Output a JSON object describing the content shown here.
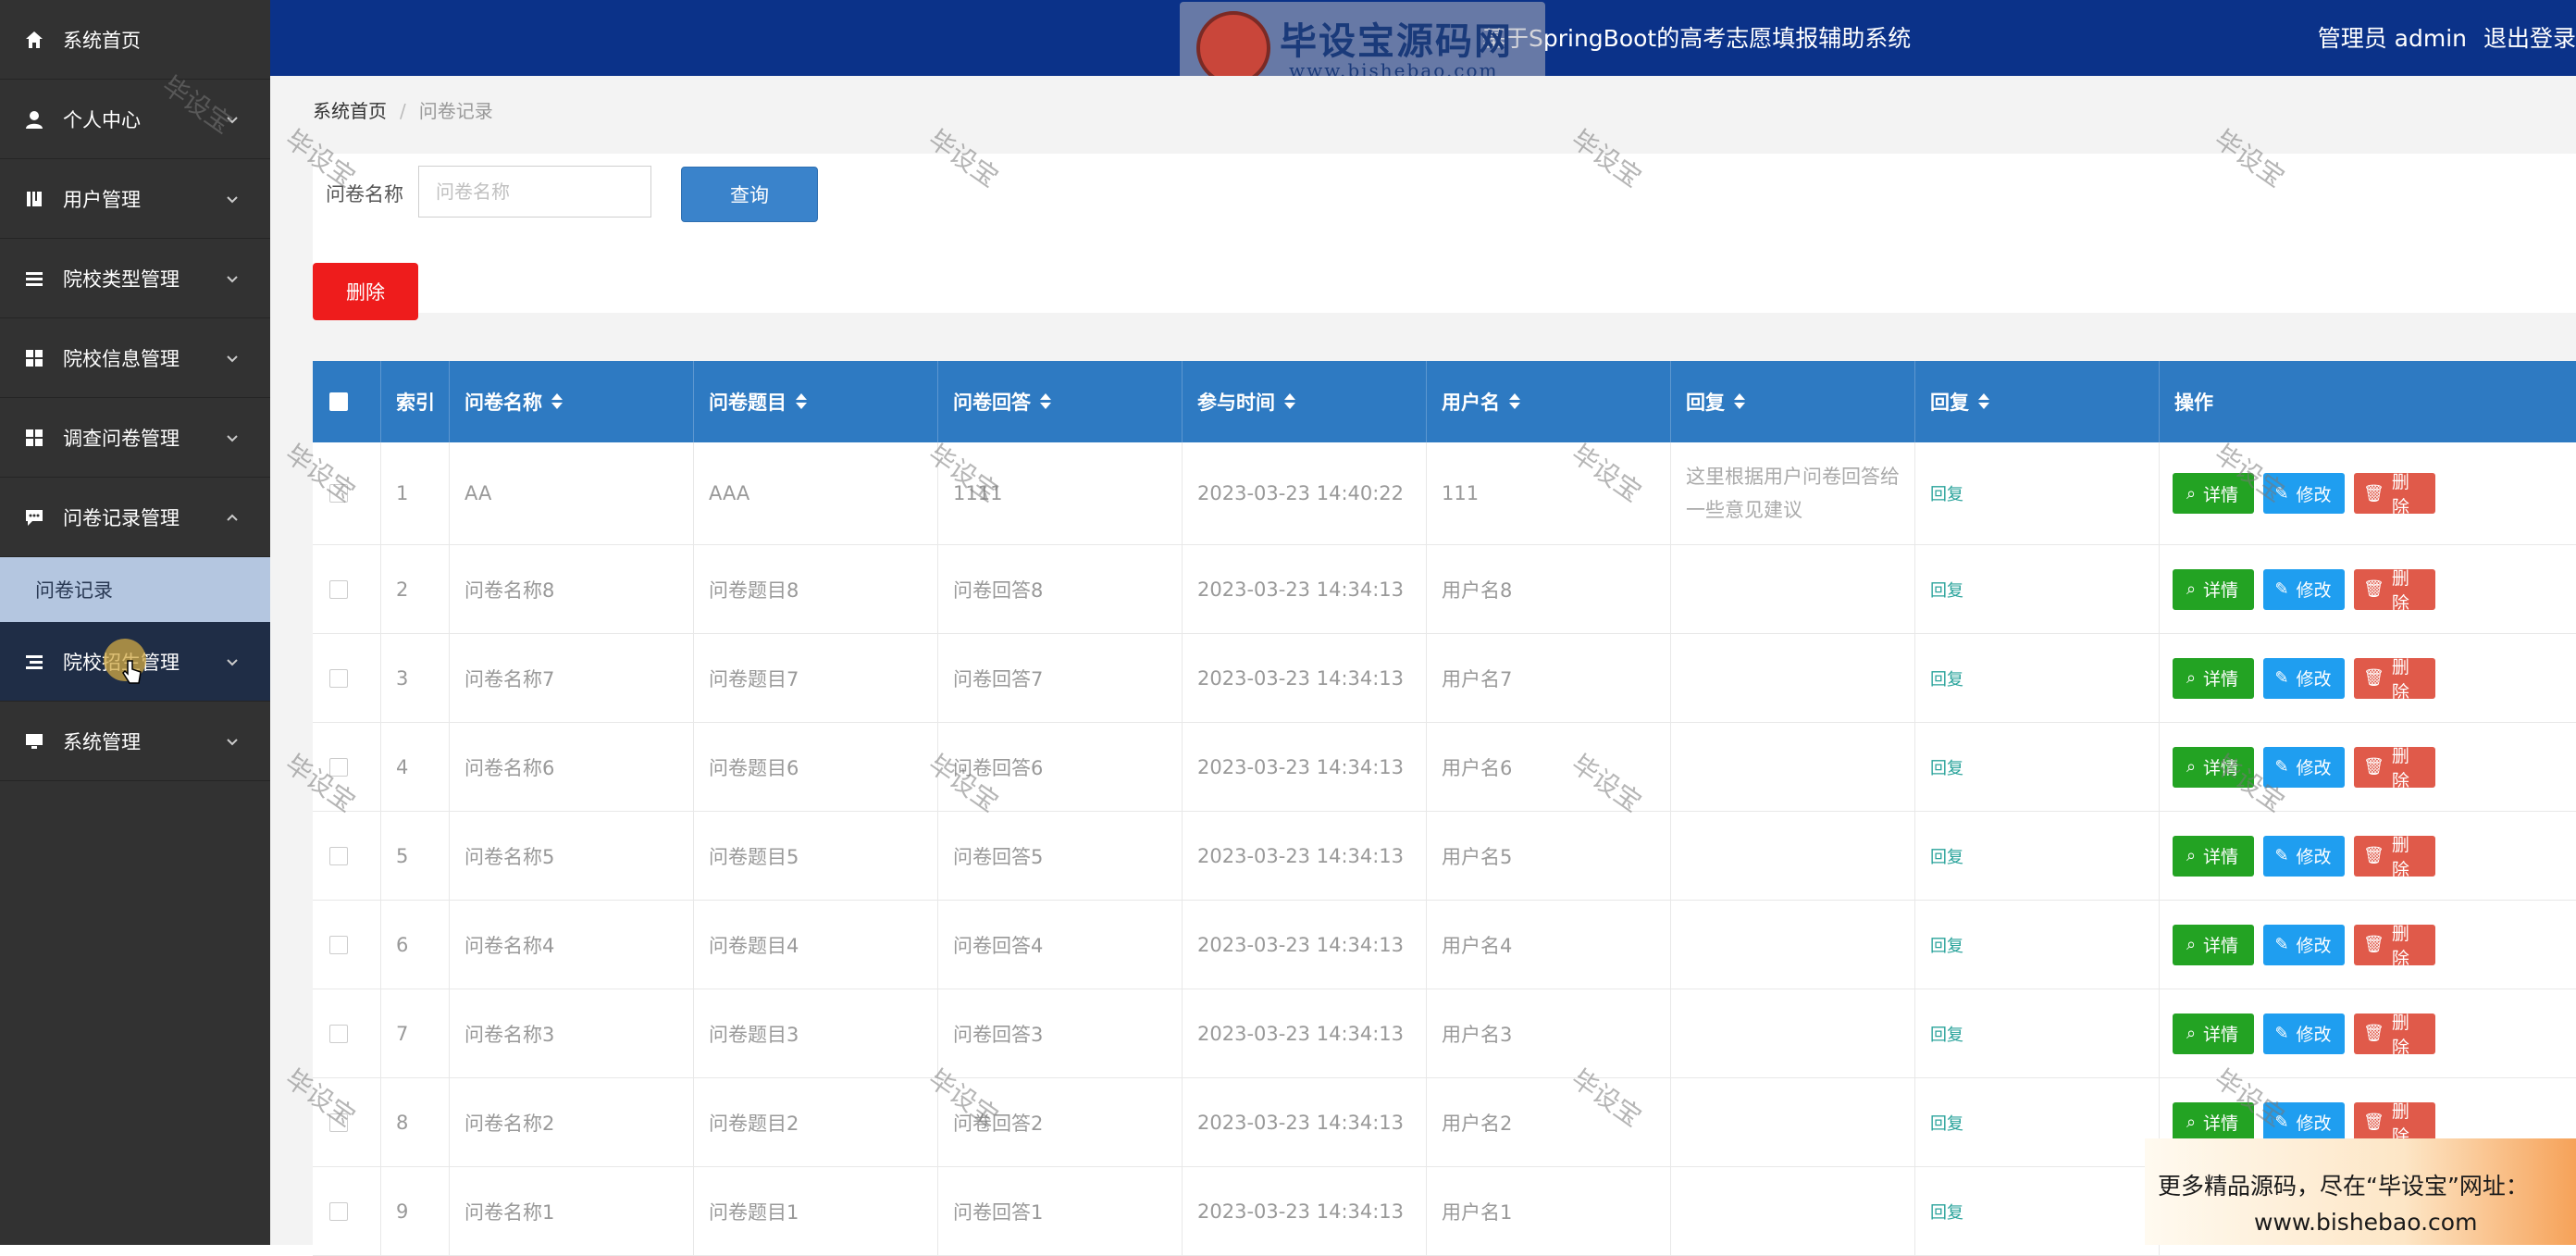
{
  "sidebar": {
    "items": [
      {
        "label": "系统首页",
        "icon": "home-icon"
      },
      {
        "label": "个人中心",
        "icon": "user-icon"
      },
      {
        "label": "用户管理",
        "icon": "book-icon"
      },
      {
        "label": "院校类型管理",
        "icon": "list-icon"
      },
      {
        "label": "院校信息管理",
        "icon": "grid-icon"
      },
      {
        "label": "调查问卷管理",
        "icon": "grid-icon"
      },
      {
        "label": "问卷记录管理",
        "icon": "chat-icon"
      },
      {
        "label": "院校招生管理",
        "icon": "list-icon"
      },
      {
        "label": "系统管理",
        "icon": "monitor-icon"
      }
    ],
    "sub_item": "问卷记录"
  },
  "header": {
    "title": "基于SpringBoot的高考志愿填报辅助系统",
    "user": "管理员 admin",
    "logout": "退出登录",
    "watermark_logo_text": "毕设宝源码网",
    "watermark_logo_url": "www.bishebao.com"
  },
  "breadcrumb": {
    "home": "系统首页",
    "current": "问卷记录"
  },
  "search": {
    "label": "问卷名称",
    "placeholder": "问卷名称",
    "button": "查询"
  },
  "toolbar": {
    "delete": "删除"
  },
  "table": {
    "headers": [
      "索引",
      "问卷名称",
      "问卷题目",
      "问卷回答",
      "参与时间",
      "用户名",
      "回复",
      "回复",
      "操作"
    ],
    "rows": [
      {
        "idx": "1",
        "name": "AA",
        "title": "AAA",
        "answer": "1111",
        "time": "2023-03-23 14:40:22",
        "user": "111",
        "reply": "这里根据用户问卷回答给一些意见建议",
        "reply_link": "回复"
      },
      {
        "idx": "2",
        "name": "问卷名称8",
        "title": "问卷题目8",
        "answer": "问卷回答8",
        "time": "2023-03-23 14:34:13",
        "user": "用户名8",
        "reply": "",
        "reply_link": "回复"
      },
      {
        "idx": "3",
        "name": "问卷名称7",
        "title": "问卷题目7",
        "answer": "问卷回答7",
        "time": "2023-03-23 14:34:13",
        "user": "用户名7",
        "reply": "",
        "reply_link": "回复"
      },
      {
        "idx": "4",
        "name": "问卷名称6",
        "title": "问卷题目6",
        "answer": "问卷回答6",
        "time": "2023-03-23 14:34:13",
        "user": "用户名6",
        "reply": "",
        "reply_link": "回复"
      },
      {
        "idx": "5",
        "name": "问卷名称5",
        "title": "问卷题目5",
        "answer": "问卷回答5",
        "time": "2023-03-23 14:34:13",
        "user": "用户名5",
        "reply": "",
        "reply_link": "回复"
      },
      {
        "idx": "6",
        "name": "问卷名称4",
        "title": "问卷题目4",
        "answer": "问卷回答4",
        "time": "2023-03-23 14:34:13",
        "user": "用户名4",
        "reply": "",
        "reply_link": "回复"
      },
      {
        "idx": "7",
        "name": "问卷名称3",
        "title": "问卷题目3",
        "answer": "问卷回答3",
        "time": "2023-03-23 14:34:13",
        "user": "用户名3",
        "reply": "",
        "reply_link": "回复"
      },
      {
        "idx": "8",
        "name": "问卷名称2",
        "title": "问卷题目2",
        "answer": "问卷回答2",
        "time": "2023-03-23 14:34:13",
        "user": "用户名2",
        "reply": "",
        "reply_link": "回复"
      },
      {
        "idx": "9",
        "name": "问卷名称1",
        "title": "问卷题目1",
        "answer": "问卷回答1",
        "time": "2023-03-23 14:34:13",
        "user": "用户名1",
        "reply": "",
        "reply_link": "回复"
      }
    ],
    "ops": {
      "detail": "详情",
      "edit": "修改",
      "delete": "删除"
    }
  },
  "watermark_text": "毕设宝",
  "promo": {
    "line1": "更多精品源码，尽在“毕设宝”网址：",
    "line2": "www.bishebao.com"
  },
  "colors": {
    "header_bg": "#0b3289",
    "table_head": "#2e7ac2",
    "sidebar_bg": "#323232",
    "delete_red": "#ee1c1c",
    "detail_green": "#23a323",
    "edit_blue": "#1f9ef0",
    "op_delete": "#e05a4a"
  }
}
